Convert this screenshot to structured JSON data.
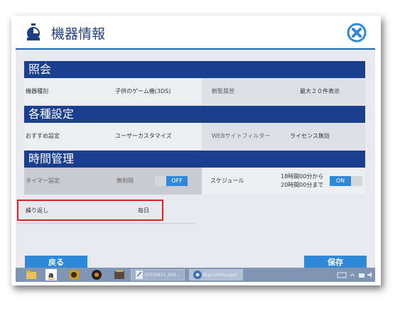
{
  "window": {
    "title": "機器情報"
  },
  "sections": {
    "inquiry": {
      "heading": "照会",
      "device_type_label": "機器種別",
      "device_type_value": "子供のゲーム機(3DS)",
      "history_label": "観覧履歴",
      "history_value": "最大２０件表示"
    },
    "settings": {
      "heading": "各種設定",
      "recommend_label": "おすすめ設定",
      "recommend_value": "ユーザーカスタマイズ",
      "web_filter_label": "WEBサイトフィルター",
      "web_filter_value": "ライセンス無効"
    },
    "time": {
      "heading": "時間管理",
      "timer_label": "タイマー設定",
      "timer_value": "無制限",
      "timer_toggle": "OFF",
      "schedule_label": "スケジュール",
      "schedule_line1": "18時間00分から",
      "schedule_line2": "20時間00分まで",
      "schedule_toggle": "ON",
      "repeat_label": "繰り返し",
      "repeat_value": "毎日"
    }
  },
  "buttons": {
    "back": "戻る",
    "save": "保存"
  },
  "taskbar": {
    "task1": "20150611_042...",
    "task2": "SkyLinkManager"
  },
  "colors": {
    "section_header": "#1b3f8f",
    "accent": "#2f88d8",
    "highlight": "#e02020"
  }
}
